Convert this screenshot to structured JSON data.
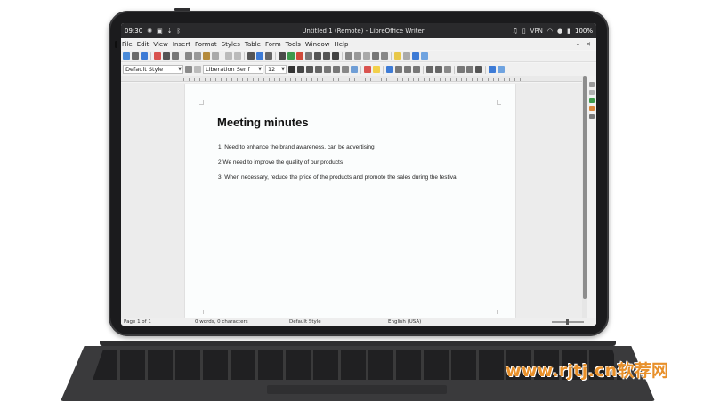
{
  "device": {
    "status_bar": {
      "time": "09:30",
      "battery": "100%",
      "vpn": "VPN"
    }
  },
  "window": {
    "title": "Untitled 1 (Remote) - LibreOffice Writer"
  },
  "menu": {
    "items": [
      "File",
      "Edit",
      "View",
      "Insert",
      "Format",
      "Styles",
      "Table",
      "Form",
      "Tools",
      "Window",
      "Help"
    ]
  },
  "format_bar": {
    "paragraph_style": "Default Style",
    "font_name": "Liberation Serif",
    "font_size": "12"
  },
  "document": {
    "title": "Meeting minutes",
    "lines": [
      "1. Need to enhance the brand awareness, can be advertising",
      "2.We need to improve the quality of our products",
      "3. When necessary, reduce the price of the products and promote the sales during the festival"
    ]
  },
  "status_line": {
    "page": "Page 1 of 1",
    "words": "0 words, 0 characters",
    "style": "Default Style",
    "language": "English (USA)"
  },
  "watermark": "www.rjtj.cn软荐网",
  "colors": {
    "accent_blue": "#3d7bd6",
    "watermark_orange": "#e8902a",
    "tablet_frame": "#1b1b1d"
  }
}
